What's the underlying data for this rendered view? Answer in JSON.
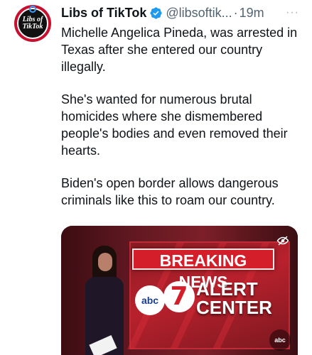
{
  "tweet": {
    "author_name": "Libs of TikTok",
    "handle": "@libsoftik...",
    "separator": "·",
    "time": "19m",
    "more_label": "···",
    "avatar_text_line1": "Libs of",
    "avatar_text_line2": "TikTok",
    "paragraphs": [
      "Michelle Angelica Pineda, was arrested in Texas after she entered our country illegally.",
      "She's wanted for numerous brutal homicides where she dismembered people's bodies and even removed their hearts.",
      "Biden's open border allows dangerous criminals like this to roam our country."
    ]
  },
  "media": {
    "headline": "BREAKING NEWS",
    "station_logo": "abc",
    "channel_number": "7",
    "alert_line1": "ALERT",
    "alert_line2": "CENTER",
    "corner_badge": "abc"
  },
  "colors": {
    "verified_blue": "#1d9bf0",
    "breaking_red": "#d41f2b",
    "text_primary": "#0f1419",
    "text_secondary": "#536471"
  },
  "icons": {
    "verified": "verified-badge-icon",
    "more": "more-options-icon",
    "sensitive_toggle": "eye-slash-icon",
    "volume": "volume-icon"
  }
}
